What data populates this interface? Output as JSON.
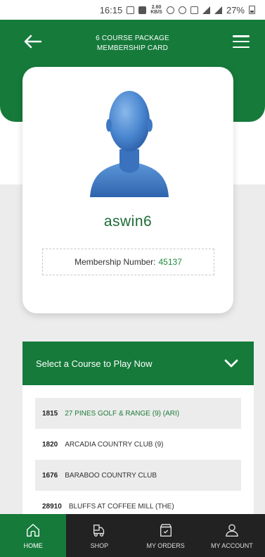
{
  "status_bar": {
    "time": "16:15",
    "net_speed_top": "2.60",
    "net_speed_bottom": "KB/S",
    "battery": "27%"
  },
  "header": {
    "title_line1": "6 COURSE PACKAGE",
    "title_line2": "MEMBERSHIP CARD"
  },
  "profile": {
    "username": "aswin6",
    "membership_label": "Membership Number:",
    "membership_number": "45137"
  },
  "course_select": {
    "label": "Select a Course to Play Now"
  },
  "courses": [
    {
      "id": "1815",
      "name": "27 PINES GOLF & RANGE (9) (ARI)"
    },
    {
      "id": "1820",
      "name": "ARCADIA COUNTRY CLUB (9)"
    },
    {
      "id": "1676",
      "name": "BARABOO COUNTRY CLUB"
    },
    {
      "id": "28910",
      "name": "BLUFFS AT COFFEE MILL (THE)"
    }
  ],
  "bottom_nav": [
    {
      "label": "HOME",
      "icon": "home-icon"
    },
    {
      "label": "SHOP",
      "icon": "delivery-icon"
    },
    {
      "label": "MY ORDERS",
      "icon": "orders-box-icon"
    },
    {
      "label": "MY ACCOUNT",
      "icon": "user-icon"
    }
  ],
  "colors": {
    "brand_green": "#157a3a",
    "nav_dark": "#222222",
    "grey_bg": "#ececec"
  }
}
